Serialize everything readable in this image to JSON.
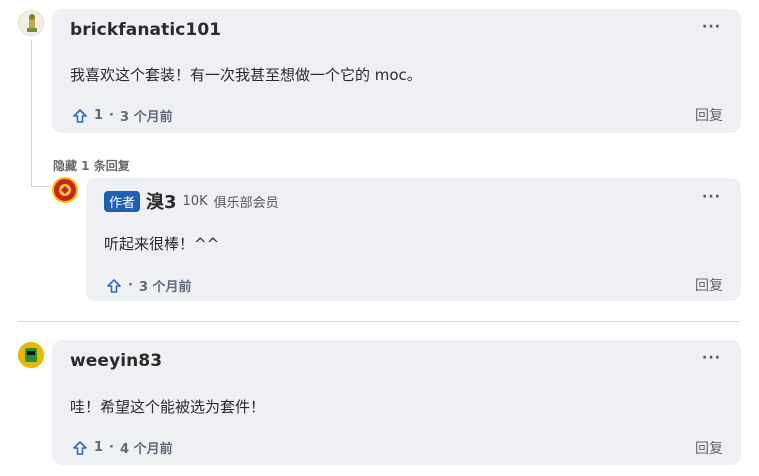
{
  "comments": [
    {
      "author": "brickfanatic101",
      "text": "我喜欢这个套装！有一次我甚至想做一个它的 moc。",
      "votes": "1",
      "separator": "·",
      "time": "3 个月前",
      "reply_label": "回复",
      "more_label": "···",
      "hide_replies_label": "隐藏 1 条回复",
      "reply": {
        "op_badge": "作者",
        "author": "溴3",
        "member_count": "10K",
        "member_label": "俱乐部会员",
        "text": "听起来很棒！^^",
        "separator": "·",
        "time": "3 个月前",
        "reply_label": "回复",
        "more_label": "···"
      }
    },
    {
      "author": "weeyin83",
      "text": "哇！希望这个能被选为套件！",
      "votes": "1",
      "separator": "·",
      "time": "4 个月前",
      "reply_label": "回复",
      "more_label": "···"
    }
  ],
  "colors": {
    "card_bg": "#eef0f4",
    "upvote_icon": "#2a6db8",
    "op_badge_bg": "#1e5fb4"
  },
  "icons": [
    "upvote-arrow-icon",
    "more-options-icon"
  ]
}
